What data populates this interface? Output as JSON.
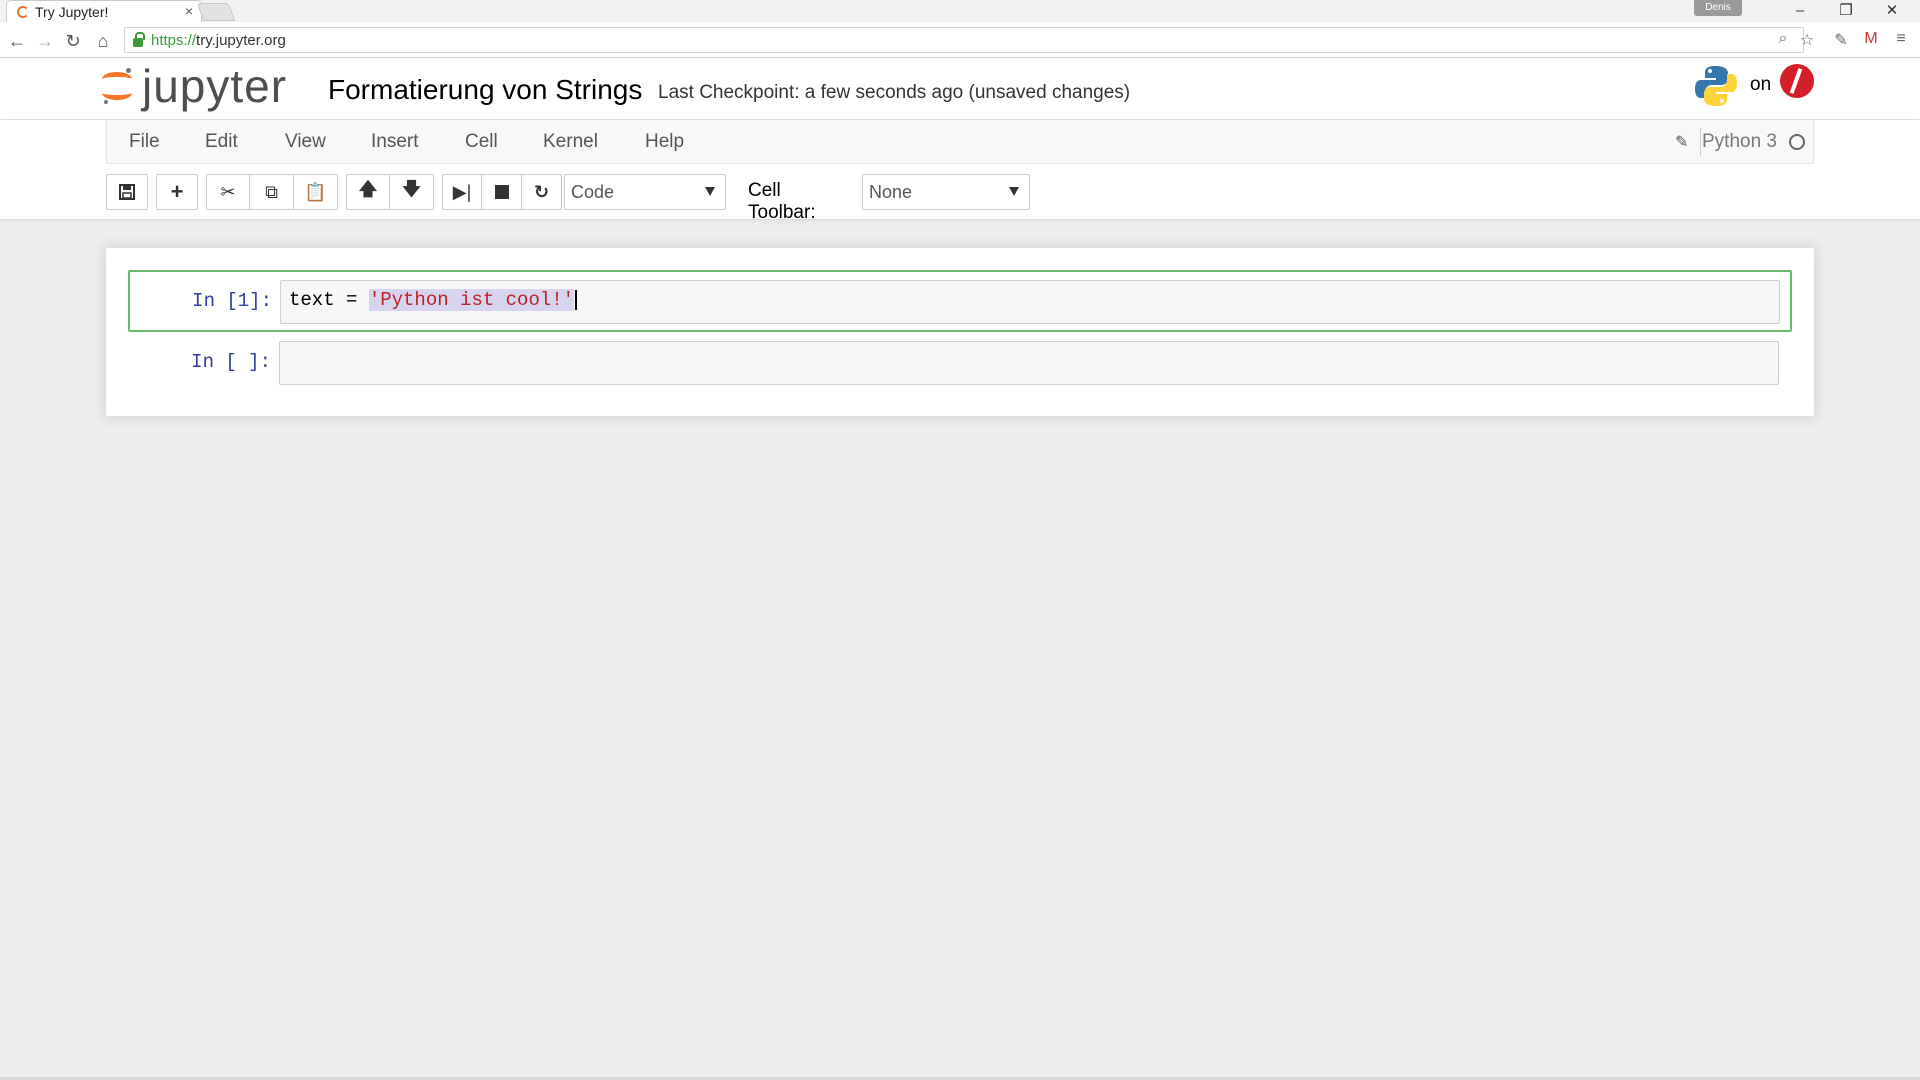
{
  "browser": {
    "tab_title": "Try Jupyter!",
    "tab_close": "×",
    "user_chip": "Denis",
    "window_controls": {
      "minimize": "–",
      "restore": "❐",
      "close": "✕"
    },
    "nav": {
      "back": "←",
      "forward": "→",
      "reload": "↻",
      "home": "⌂"
    },
    "url_scheme": "https://",
    "url_host": "try.jupyter.org"
  },
  "header": {
    "logo_text": "jupyter",
    "notebook_title": "Formatierung von Strings",
    "checkpoint": "Last Checkpoint: a few seconds ago (unsaved changes)",
    "powered_on": "on"
  },
  "menubar": {
    "items": [
      "File",
      "Edit",
      "View",
      "Insert",
      "Cell",
      "Kernel",
      "Help"
    ],
    "kernel_name": "Python 3"
  },
  "toolbar": {
    "cell_type": "Code",
    "cell_toolbar_label": "Cell Toolbar:",
    "cell_toolbar_value": "None"
  },
  "cells": [
    {
      "prompt": "In [1]:",
      "code_prefix": "text = ",
      "code_string": "'Python ist cool!'"
    },
    {
      "prompt": "In [ ]:",
      "code": ""
    }
  ],
  "colors": {
    "jupyter_orange": "#f37726",
    "selected_cell_border": "#66bb6a",
    "prompt_blue": "#303f9f",
    "string_red": "#ba2121"
  }
}
